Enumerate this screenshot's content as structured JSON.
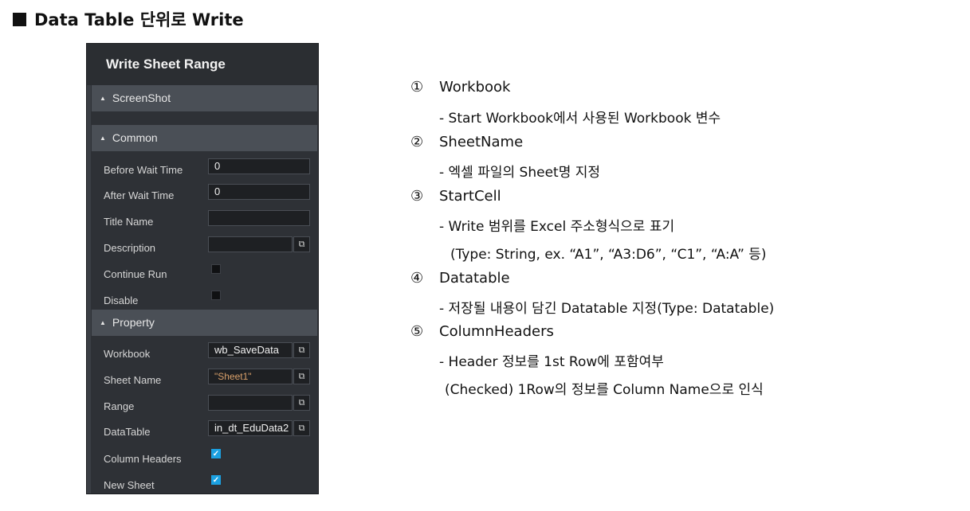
{
  "heading": "Data Table 단위로 Write",
  "panel": {
    "title": "Write Sheet Range",
    "sections": {
      "screenshot": "ScreenShot",
      "common": "Common",
      "property": "Property"
    },
    "common": {
      "before_wait_time": {
        "label": "Before Wait Time",
        "value": "0"
      },
      "after_wait_time": {
        "label": "After Wait Time",
        "value": "0"
      },
      "title_name": {
        "label": "Title Name",
        "value": ""
      },
      "description": {
        "label": "Description",
        "value": ""
      },
      "continue_run": {
        "label": "Continue Run",
        "checked": false
      },
      "disable": {
        "label": "Disable",
        "checked": false
      }
    },
    "property": {
      "workbook": {
        "label": "Workbook",
        "value": "wb_SaveData"
      },
      "sheet_name": {
        "label": "Sheet Name",
        "value": "\"Sheet1\""
      },
      "range": {
        "label": "Range",
        "value": ""
      },
      "datatable": {
        "label": "DataTable",
        "value": "in_dt_EduData2"
      },
      "column_headers": {
        "label": "Column Headers",
        "checked": true
      },
      "new_sheet": {
        "label": "New Sheet",
        "checked": true
      }
    },
    "picker_icon": "external-link-icon",
    "accent_color": "#1ba1e2"
  },
  "notes": [
    {
      "num": "①",
      "title": "Workbook",
      "lines": [
        "- Start Workbook에서 사용된 Workbook 변수"
      ]
    },
    {
      "num": "②",
      "title": "SheetName",
      "lines": [
        "- 엑셀 파일의 Sheet명 지정"
      ]
    },
    {
      "num": "③",
      "title": "StartCell",
      "lines": [
        "- Write 범위를 Excel 주소형식으로 표기",
        "(Type: String, ex. “A1”, “A3:D6”, “C1”, “A:A” 등)"
      ]
    },
    {
      "num": "④",
      "title": "Datatable",
      "lines": [
        "- 저장될 내용이 담긴 Datatable 지정(Type: Datatable)"
      ]
    },
    {
      "num": "⑤",
      "title": "ColumnHeaders",
      "lines": [
        "- Header 정보를 1st Row에 포함여부",
        "(Checked) 1Row의 정보를 Column Name으로 인식"
      ]
    }
  ]
}
